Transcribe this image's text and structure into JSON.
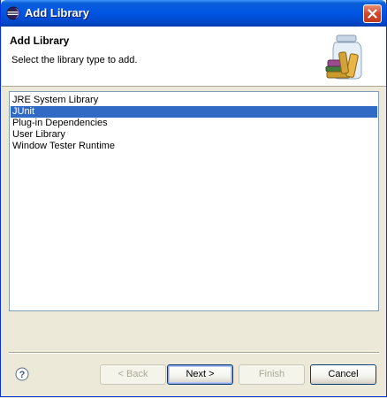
{
  "window": {
    "title": "Add Library"
  },
  "header": {
    "title": "Add Library",
    "description": "Select the library type to add."
  },
  "library_types": [
    {
      "label": "JRE System Library",
      "selected": false
    },
    {
      "label": "JUnit",
      "selected": true
    },
    {
      "label": "Plug-in Dependencies",
      "selected": false
    },
    {
      "label": "User Library",
      "selected": false
    },
    {
      "label": "Window Tester Runtime",
      "selected": false
    }
  ],
  "buttons": {
    "back": "< Back",
    "next": "Next >",
    "finish": "Finish",
    "cancel": "Cancel"
  },
  "colors": {
    "title_bar": "#0055e5",
    "selection": "#316ac5",
    "dialog_bg": "#ece9d8"
  },
  "icons": {
    "title": "eclipse-icon",
    "close": "close-icon",
    "banner": "library-jar-icon",
    "help": "help-icon"
  }
}
